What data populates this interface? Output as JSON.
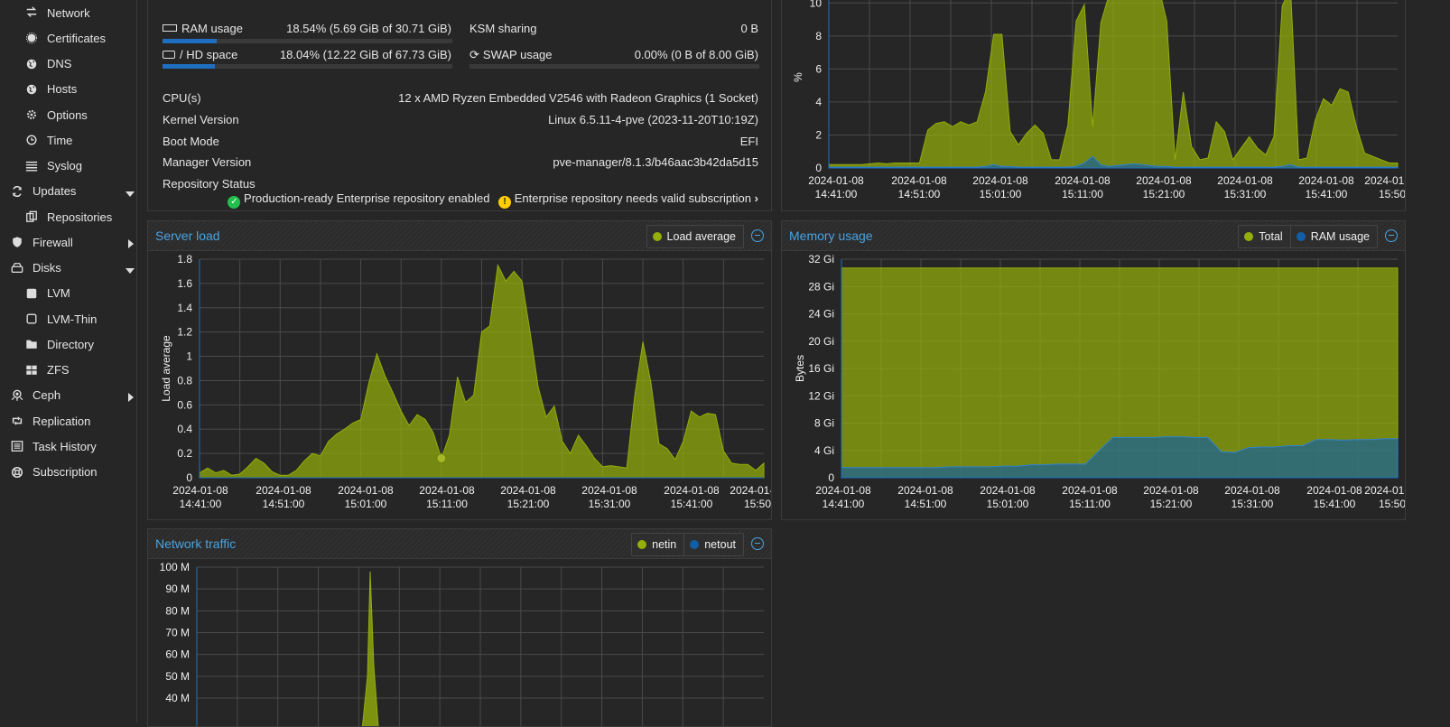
{
  "sidebar": {
    "items": [
      {
        "label": "Network",
        "icon": "arrows-exchange-icon",
        "level": "sub"
      },
      {
        "label": "Certificates",
        "icon": "certificate-icon",
        "level": "sub"
      },
      {
        "label": "DNS",
        "icon": "globe-icon",
        "level": "sub"
      },
      {
        "label": "Hosts",
        "icon": "globe-icon",
        "level": "sub"
      },
      {
        "label": "Options",
        "icon": "gear-icon",
        "level": "sub"
      },
      {
        "label": "Time",
        "icon": "clock-icon",
        "level": "sub"
      },
      {
        "label": "Syslog",
        "icon": "list-icon",
        "level": "sub"
      },
      {
        "label": "Updates",
        "icon": "refresh-icon",
        "level": "top",
        "caret": "down"
      },
      {
        "label": "Repositories",
        "icon": "files-icon",
        "level": "sub"
      },
      {
        "label": "Firewall",
        "icon": "shield-icon",
        "level": "top",
        "caret": "right"
      },
      {
        "label": "Disks",
        "icon": "hdd-icon",
        "level": "top",
        "caret": "down"
      },
      {
        "label": "LVM",
        "icon": "square-icon",
        "level": "sub"
      },
      {
        "label": "LVM-Thin",
        "icon": "square-outline-icon",
        "level": "sub"
      },
      {
        "label": "Directory",
        "icon": "folder-icon",
        "level": "sub"
      },
      {
        "label": "ZFS",
        "icon": "grid-icon",
        "level": "sub"
      },
      {
        "label": "Ceph",
        "icon": "ceph-icon",
        "level": "top",
        "caret": "right"
      },
      {
        "label": "Replication",
        "icon": "retweet-icon",
        "level": "top"
      },
      {
        "label": "Task History",
        "icon": "list-alt-icon",
        "level": "top"
      },
      {
        "label": "Subscription",
        "icon": "support-icon",
        "level": "top"
      }
    ]
  },
  "status": {
    "ram_label": "RAM usage",
    "ram_value": "18.54% (5.69 GiB of 30.71 GiB)",
    "ram_fraction": 0.1854,
    "hd_label": "/ HD space",
    "hd_value": "18.04% (12.22 GiB of 67.73 GiB)",
    "hd_fraction": 0.1804,
    "ksm_label": "KSM sharing",
    "ksm_value": "0 B",
    "swap_label": "SWAP usage",
    "swap_value": "0.00% (0 B of 8.00 GiB)",
    "swap_fraction": 0.0,
    "cpu_label": "CPU(s)",
    "cpu_value": "12 x AMD Ryzen Embedded V2546 with Radeon Graphics (1 Socket)",
    "kernel_label": "Kernel Version",
    "kernel_value": "Linux 6.5.11-4-pve (2023-11-20T10:19Z)",
    "boot_label": "Boot Mode",
    "boot_value": "EFI",
    "manager_label": "Manager Version",
    "manager_value": "pve-manager/8.1.3/b46aac3b42da5d15",
    "repo_label": "Repository Status",
    "repo_ok": "Production-ready Enterprise repository enabled",
    "repo_warn": "Enterprise repository needs valid subscription"
  },
  "colors": {
    "accent": "#4aa3e0",
    "series1": "#94ae0a",
    "series2": "#115fa6",
    "ok": "#21bf4b",
    "warn": "#ffcc00"
  },
  "chart_data": [
    {
      "id": "cpu",
      "type": "area",
      "title": "",
      "ylabel": "%",
      "ylim": [
        0,
        11
      ],
      "yticks": [
        0,
        2,
        4,
        6,
        8,
        10
      ],
      "x_ticks": [
        "2024-01-08 14:41:00",
        "2024-01-08 14:51:00",
        "2024-01-08 15:01:00",
        "2024-01-08 15:11:00",
        "2024-01-08 15:21:00",
        "2024-01-08 15:31:00",
        "2024-01-08 15:41:00",
        "2024-01-08 15:50"
      ],
      "series": [
        {
          "values": [
            0.2,
            0.2,
            0.2,
            0.2,
            0.2,
            0.25,
            0.3,
            0.25,
            0.3,
            0.3,
            0.3,
            0.3,
            2.3,
            2.7,
            2.8,
            2.5,
            2.8,
            2.6,
            2.8,
            4.6,
            8.1,
            8.1,
            2.2,
            1.4,
            2.1,
            2.6,
            2.1,
            0.5,
            0.5,
            2.6,
            8.9,
            9.9,
            2.5,
            8.8,
            10.5,
            11,
            10.4,
            10.7,
            11,
            11.2,
            11,
            8.9,
            0.5,
            4.6,
            1.3,
            0.5,
            0.6,
            2.8,
            2.2,
            0.5,
            1.2,
            1.9,
            1.2,
            0.8,
            1.9,
            9.8,
            11.2,
            0.5,
            0.6,
            2.9,
            4.2,
            3.8,
            4.8,
            4.6,
            2.5,
            0.9,
            0.7,
            0.5,
            0.3,
            0.3
          ]
        },
        {
          "values": [
            0.05,
            0.05,
            0.05,
            0.05,
            0.05,
            0.05,
            0.05,
            0.05,
            0.05,
            0.05,
            0.05,
            0.05,
            0.05,
            0.05,
            0.05,
            0.05,
            0.05,
            0.05,
            0.05,
            0.1,
            0.2,
            0.1,
            0.1,
            0.05,
            0.05,
            0.05,
            0.05,
            0.05,
            0.05,
            0.05,
            0.1,
            0.3,
            0.7,
            0.2,
            0.1,
            0.15,
            0.2,
            0.25,
            0.2,
            0.15,
            0.1,
            0.1,
            0.05,
            0.05,
            0.05,
            0.05,
            0.05,
            0.05,
            0.05,
            0.05,
            0.05,
            0.05,
            0.05,
            0.05,
            0.05,
            0.1,
            0.2,
            0.05,
            0.05,
            0.05,
            0.05,
            0.05,
            0.05,
            0.05,
            0.05,
            0.05,
            0.05,
            0.05,
            0.05,
            0.05
          ]
        }
      ]
    },
    {
      "id": "load",
      "type": "area",
      "title": "Server load",
      "ylabel": "Load average",
      "ylim": [
        0,
        1.8
      ],
      "yticks": [
        0,
        0.2,
        0.4,
        0.6,
        0.8,
        1,
        1.2,
        1.4,
        1.6,
        1.8
      ],
      "x_ticks": [
        "2024-01-08 14:41:00",
        "2024-01-08 14:51:00",
        "2024-01-08 15:01:00",
        "2024-01-08 15:11:00",
        "2024-01-08 15:21:00",
        "2024-01-08 15:31:00",
        "2024-01-08 15:41:00",
        "2024-01-08 15:50"
      ],
      "series": [
        {
          "name": "Load average",
          "values": [
            0.04,
            0.08,
            0.04,
            0.06,
            0.02,
            0.03,
            0.09,
            0.16,
            0.12,
            0.05,
            0.02,
            0.02,
            0.06,
            0.14,
            0.2,
            0.18,
            0.3,
            0.36,
            0.4,
            0.45,
            0.48,
            0.78,
            1.02,
            0.84,
            0.7,
            0.55,
            0.43,
            0.52,
            0.48,
            0.37,
            0.16,
            0.35,
            0.83,
            0.62,
            0.68,
            1.2,
            1.25,
            1.75,
            1.62,
            1.7,
            1.62,
            1.2,
            0.75,
            0.5,
            0.59,
            0.3,
            0.2,
            0.35,
            0.26,
            0.16,
            0.09,
            0.1,
            0.09,
            0.08,
            0.68,
            1.12,
            0.78,
            0.28,
            0.24,
            0.15,
            0.3,
            0.55,
            0.5,
            0.53,
            0.52,
            0.22,
            0.12,
            0.11,
            0.11,
            0.06,
            0.12
          ]
        }
      ],
      "highlight_index": 30
    },
    {
      "id": "mem",
      "type": "area",
      "title": "Memory usage",
      "ylabel": "Bytes",
      "ylim": [
        0,
        32
      ],
      "yticks": [
        0,
        4,
        8,
        12,
        16,
        20,
        24,
        28,
        32
      ],
      "ytick_labels": [
        "0",
        "4 Gi",
        "8 Gi",
        "12 Gi",
        "16 Gi",
        "20 Gi",
        "24 Gi",
        "28 Gi",
        "32 Gi"
      ],
      "x_ticks": [
        "2024-01-08 14:41:00",
        "2024-01-08 14:51:00",
        "2024-01-08 15:01:00",
        "2024-01-08 15:11:00",
        "2024-01-08 15:21:00",
        "2024-01-08 15:31:00",
        "2024-01-08 15:41:00",
        "2024-01-08 15:50"
      ],
      "series": [
        {
          "name": "Total",
          "values": [
            30.7,
            30.7,
            30.7,
            30.7,
            30.7,
            30.7,
            30.7,
            30.7,
            30.7,
            30.7,
            30.7,
            30.7,
            30.7,
            30.7,
            30.7,
            30.7,
            30.7,
            30.7,
            30.7,
            30.7,
            30.7,
            30.7,
            30.7,
            30.7,
            30.7,
            30.7,
            30.7,
            30.7,
            30.7,
            30.7,
            30.7,
            30.7,
            30.7,
            30.7,
            30.7,
            30.7,
            30.7,
            30.7,
            30.7,
            30.7
          ]
        },
        {
          "name": "RAM usage",
          "values": [
            1.5,
            1.5,
            1.5,
            1.5,
            1.5,
            1.5,
            1.5,
            1.5,
            1.6,
            1.6,
            1.6,
            1.6,
            1.7,
            1.7,
            1.9,
            1.9,
            2.0,
            2.0,
            2.0,
            4.0,
            5.9,
            5.9,
            5.9,
            5.9,
            6.0,
            6.0,
            5.9,
            5.9,
            3.8,
            3.7,
            4.4,
            4.5,
            4.5,
            4.7,
            4.7,
            5.6,
            5.6,
            5.5,
            5.6,
            5.6,
            5.7,
            5.7
          ]
        }
      ]
    },
    {
      "id": "net",
      "type": "area",
      "title": "Network traffic",
      "ylabel": "",
      "ylim": [
        0,
        100
      ],
      "yticks": [
        40,
        50,
        60,
        70,
        80,
        90,
        100
      ],
      "ytick_labels": [
        "40 M",
        "50 M",
        "60 M",
        "70 M",
        "80 M",
        "90 M",
        "100 M"
      ],
      "series": [
        {
          "name": "netin",
          "values": [
            0,
            0,
            0,
            0,
            0,
            0,
            0,
            0,
            0,
            0,
            0,
            0,
            0,
            0,
            0,
            0,
            0,
            0,
            0,
            0,
            0,
            0,
            0,
            0,
            0,
            0,
            0,
            0,
            0,
            0,
            0,
            0,
            0,
            0,
            0,
            0,
            0,
            0,
            0,
            0,
            0,
            0,
            0,
            0,
            0,
            0,
            0,
            0,
            0,
            0,
            0,
            0,
            0,
            0,
            0,
            0,
            0,
            0,
            0,
            0,
            0,
            0,
            0,
            0,
            0,
            0,
            0,
            0,
            0,
            0
          ]
        },
        {
          "name": "netout",
          "values": []
        }
      ]
    }
  ]
}
